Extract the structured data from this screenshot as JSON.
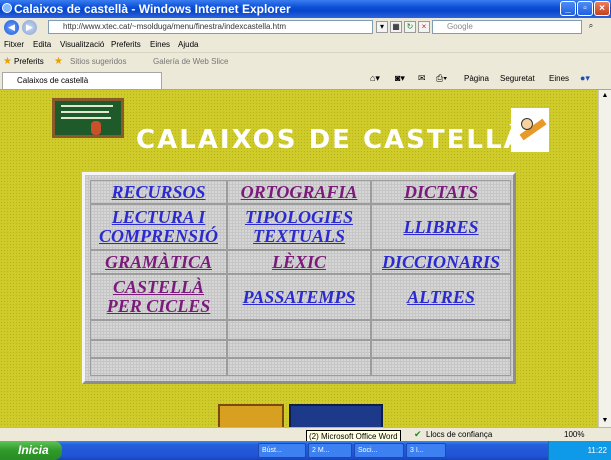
{
  "window": {
    "title": "Calaixos de castellà - Windows Internet Explorer"
  },
  "address": {
    "url": "http://www.xtec.cat/~msolduga/menu/finestra/indexcastella.htm"
  },
  "search": {
    "placeholder": "Google"
  },
  "menu": [
    "Fitxer",
    "Edita",
    "Visualització",
    "Preferits",
    "Eines",
    "Ajuda"
  ],
  "favorites": {
    "label": "Preferits",
    "items": [
      "Sitios sugeridos",
      "Galería de Web Slice"
    ]
  },
  "tab": {
    "label": "Calaixos de castellà"
  },
  "command_bar": {
    "page": "Pàgina",
    "security": "Seguretat",
    "tools": "Eines"
  },
  "page": {
    "heading": "CALAIXOS DE CASTELLÀ",
    "links": [
      [
        "RECURSOS",
        "ORTOGRAFIA",
        "DICTATS"
      ],
      [
        "LECTURA I COMPRENSIÓ",
        "TIPOLOGIES TEXTUALS",
        "LLIBRES"
      ],
      [
        "GRAMÀTICA",
        "LÈXIC",
        "DICCIONARIS"
      ],
      [
        "CASTELLÀ PER CICLES",
        "PASSATEMPS",
        "ALTRES"
      ]
    ]
  },
  "status": {
    "zone": "Llocs de confiança",
    "zoom": "100%"
  },
  "taskbar": {
    "start": "Inicia",
    "buttons": [
      "Búst...",
      "2 M...",
      "Soci...",
      "3 I..."
    ],
    "tooltip": "(2) Microsoft Office Word",
    "clock": "11:22"
  },
  "colors": {
    "page_bg": "#cfcc2a",
    "link_blue": "#2a2ad0",
    "link_visited": "#7a1a7a"
  }
}
